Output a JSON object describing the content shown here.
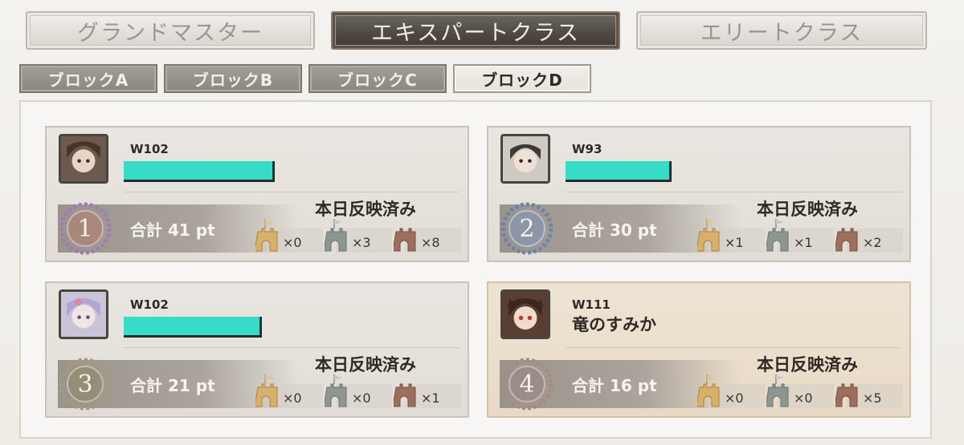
{
  "class_tabs": [
    {
      "label": "グランドマスター",
      "active": false
    },
    {
      "label": "エキスパートクラス",
      "active": true
    },
    {
      "label": "エリートクラス",
      "active": false
    }
  ],
  "block_tabs": [
    {
      "label": "ブロックA",
      "active": false
    },
    {
      "label": "ブロックB",
      "active": false
    },
    {
      "label": "ブロックC",
      "active": false
    },
    {
      "label": "ブロックD",
      "active": true
    }
  ],
  "cards": [
    {
      "rank": "1",
      "world": "W102",
      "name": "",
      "name_hidden": true,
      "status": "本日反映済み",
      "total": "合計 41 pt",
      "counts": [
        "×0",
        "×3",
        "×8"
      ],
      "medal_color": "#a98ab0"
    },
    {
      "rank": "2",
      "world": "W93",
      "name": "",
      "name_hidden": true,
      "status": "本日反映済み",
      "total": "合計 30 pt",
      "counts": [
        "×1",
        "×1",
        "×2"
      ],
      "medal_color": "#7f8fa8"
    },
    {
      "rank": "3",
      "world": "W102",
      "name": "",
      "name_hidden": true,
      "status": "本日反映済み",
      "total": "合計 21 pt",
      "counts": [
        "×0",
        "×0",
        "×1"
      ],
      "medal_color": "#a79f84"
    },
    {
      "rank": "4",
      "world": "W111",
      "name": "竜のすみか",
      "name_hidden": false,
      "status": "本日反映済み",
      "total": "合計 16 pt",
      "counts": [
        "×0",
        "×0",
        "×5"
      ],
      "medal_color": "#a88f86"
    }
  ],
  "colors": {
    "redacted_bar": "#36dcc8",
    "castle_gold": "#d9b06a",
    "castle_gray": "#8e9692",
    "castle_copper": "#9b6f5c"
  }
}
